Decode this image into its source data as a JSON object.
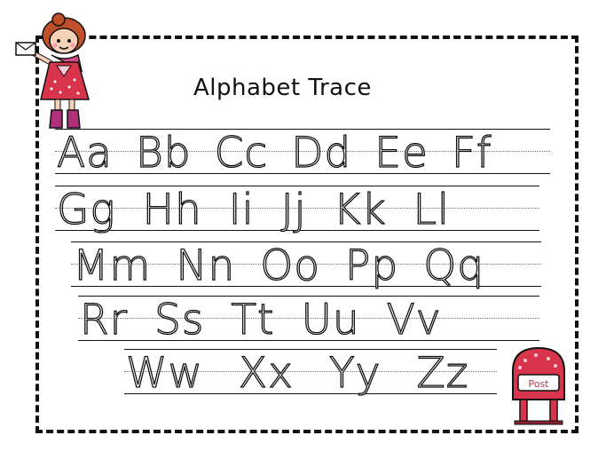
{
  "title": "Alphabet Trace",
  "rows": [
    [
      "Aa",
      "Bb",
      "Cc",
      "Dd",
      "Ee",
      "Ff"
    ],
    [
      "Gg",
      "Hh",
      "Ii",
      "Jj",
      "Kk",
      "Ll"
    ],
    [
      "Mm",
      "Nn",
      "Oo",
      "Pp",
      "Qq"
    ],
    [
      "Rr",
      "Ss",
      "Tt",
      "Uu",
      "Vv"
    ],
    [
      "Ww",
      "Xx",
      "Yy",
      "Zz"
    ]
  ],
  "mailbox_label": "Post"
}
